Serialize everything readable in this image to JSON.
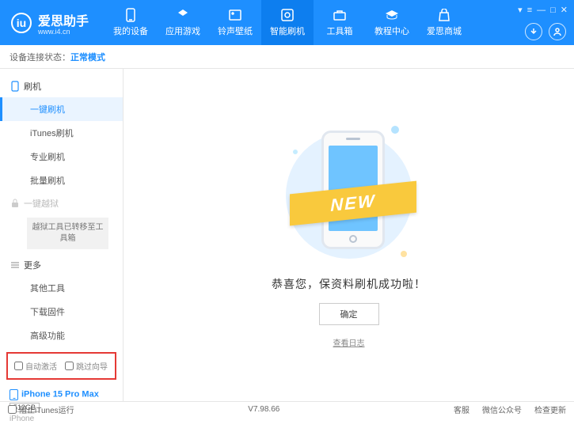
{
  "header": {
    "appName": "爱思助手",
    "urlText": "www.i4.cn",
    "logoLetter": "iu",
    "nav": [
      {
        "label": "我的设备"
      },
      {
        "label": "应用游戏"
      },
      {
        "label": "铃声壁纸"
      },
      {
        "label": "智能刷机"
      },
      {
        "label": "工具箱"
      },
      {
        "label": "教程中心"
      },
      {
        "label": "爱思商城"
      }
    ]
  },
  "status": {
    "label": "设备连接状态：",
    "value": "正常模式"
  },
  "sidebar": {
    "group1": {
      "label": "刷机"
    },
    "items1": [
      "一键刷机",
      "iTunes刷机",
      "专业刷机",
      "批量刷机"
    ],
    "group2": {
      "label": "一键越狱"
    },
    "jailbreakBox": "越狱工具已转移至工具箱",
    "group3": {
      "label": "更多"
    },
    "items3": [
      "其他工具",
      "下载固件",
      "高级功能"
    ],
    "checkboxes": {
      "autoActivate": "自动激活",
      "skipGuide": "跳过向导"
    },
    "device": {
      "name": "iPhone 15 Pro Max",
      "storage": "512GB",
      "model": "iPhone"
    }
  },
  "main": {
    "ribbon": "NEW",
    "success": "恭喜您，保资料刷机成功啦！",
    "okBtn": "确定",
    "logLink": "查看日志"
  },
  "footer": {
    "blockItunes": "阻止iTunes运行",
    "version": "V7.98.66",
    "links": [
      "客服",
      "微信公众号",
      "检查更新"
    ]
  }
}
